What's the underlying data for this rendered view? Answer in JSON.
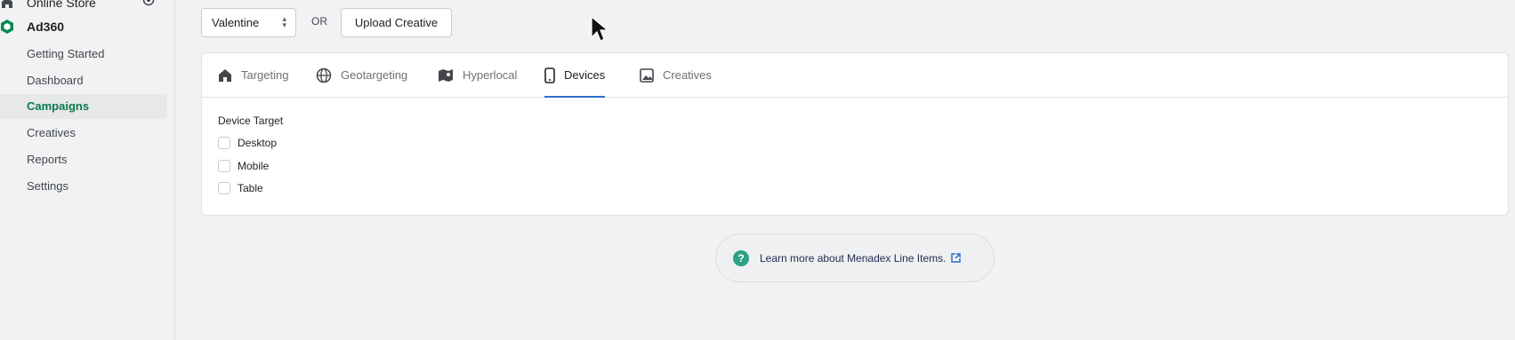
{
  "sidebar": {
    "store_label": "Online Store",
    "app_label": "Ad360",
    "items": [
      {
        "label": "Getting Started"
      },
      {
        "label": "Dashboard"
      },
      {
        "label": "Campaigns"
      },
      {
        "label": "Creatives"
      },
      {
        "label": "Reports"
      },
      {
        "label": "Settings"
      }
    ],
    "active_item": "Campaigns"
  },
  "toolbar": {
    "creative_select_value": "Valentine",
    "or_label": "OR",
    "upload_label": "Upload Creative"
  },
  "tabs": [
    {
      "label": "Targeting",
      "icon": "storefront-icon"
    },
    {
      "label": "Geotargeting",
      "icon": "globe-icon"
    },
    {
      "label": "Hyperlocal",
      "icon": "map-icon"
    },
    {
      "label": "Devices",
      "icon": "mobile-icon"
    },
    {
      "label": "Creatives",
      "icon": "image-icon"
    }
  ],
  "active_tab": "Devices",
  "devices": {
    "label": "Device Target",
    "options": [
      {
        "label": "Desktop",
        "checked": false
      },
      {
        "label": "Mobile",
        "checked": false
      },
      {
        "label": "Table",
        "checked": false
      }
    ]
  },
  "help": {
    "text": "Learn more about Menadex Line Items.",
    "icon": "question-circle-icon"
  },
  "colors": {
    "accent_green": "#0b7a4b",
    "tab_underline": "#2c6ecb",
    "help_icon": "#2ea085"
  }
}
